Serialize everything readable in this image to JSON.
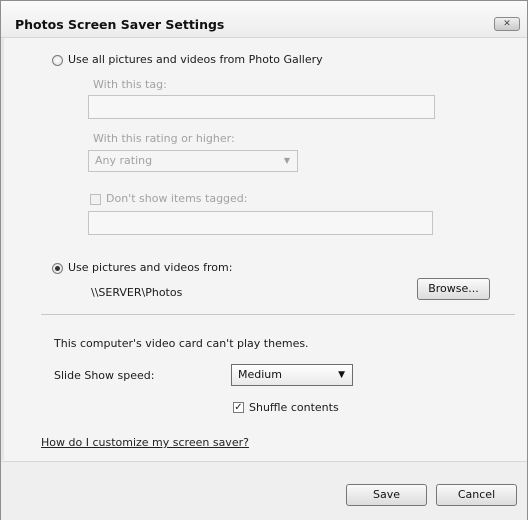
{
  "window": {
    "title": "Photos Screen Saver Settings",
    "close_glyph": "✕"
  },
  "gallery_option": {
    "label": "Use all pictures and videos from Photo Gallery",
    "selected": false,
    "tag_label": "With this tag:",
    "tag_value": "",
    "rating_label": "With this rating or higher:",
    "rating_value": "Any rating",
    "dont_show_label": "Don't show items tagged:",
    "dont_show_checked": false,
    "dont_show_value": ""
  },
  "folder_option": {
    "label": "Use pictures and videos from:",
    "selected": true,
    "path": "\\\\SERVER\\Photos",
    "browse_label": "Browse..."
  },
  "themes_message": "This computer's video card can't play themes.",
  "speed": {
    "label": "Slide Show speed:",
    "value": "Medium"
  },
  "shuffle": {
    "label": "Shuffle contents",
    "checked": true
  },
  "help_link": "How do I customize my screen saver?",
  "buttons": {
    "save": "Save",
    "cancel": "Cancel"
  },
  "icons": {
    "close": "close-icon",
    "dropdown": "chevron-down-icon",
    "check": "checkmark-icon"
  }
}
